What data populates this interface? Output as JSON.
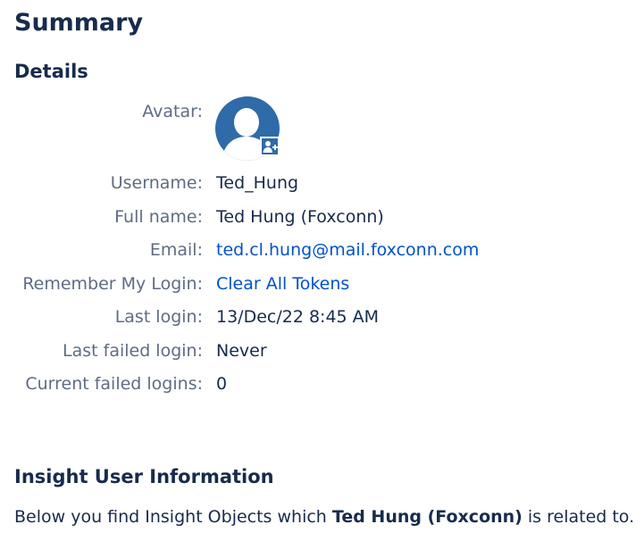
{
  "page_title": "Summary",
  "details": {
    "title": "Details",
    "avatar_label": "Avatar:",
    "avatar_icon": "user-avatar-icon",
    "username_label": "Username:",
    "username": "Ted_Hung",
    "fullname_label": "Full name:",
    "fullname": "Ted Hung (Foxconn)",
    "email_label": "Email:",
    "email": "ted.cl.hung@mail.foxconn.com",
    "remember_label": "Remember My Login:",
    "remember_link": "Clear All Tokens",
    "last_login_label": "Last login:",
    "last_login": "13/Dec/22 8:45 AM",
    "last_failed_label": "Last failed login:",
    "last_failed": "Never",
    "current_failed_label": "Current failed logins:",
    "current_failed": "0"
  },
  "insight": {
    "title": "Insight User Information",
    "text_prefix": "Below you find Insight Objects which ",
    "user_name": "Ted Hung (Foxconn)",
    "text_suffix": " is related to."
  },
  "colors": {
    "text": "#172b4d",
    "label": "#5e6c84",
    "link": "#0052cc",
    "avatar_bg": "#2f6ba8"
  }
}
